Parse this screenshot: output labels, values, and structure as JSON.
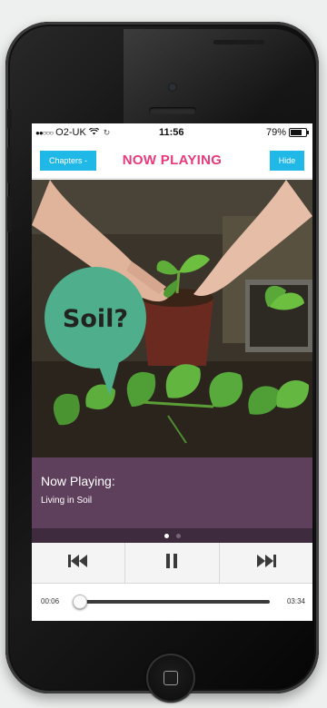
{
  "status_bar": {
    "carrier": "O2-UK",
    "time": "11:56",
    "battery": "79%"
  },
  "header": {
    "chapters_label": "Chapters -",
    "title": "NOW PLAYING",
    "hide_label": "Hide"
  },
  "artwork": {
    "bubble_text": "Soil?"
  },
  "now_playing": {
    "label": "Now Playing:",
    "track": "Living in Soil"
  },
  "pager": {
    "pages": 2,
    "active_page": 1
  },
  "controls": {
    "previous_icon": "skip-previous-icon",
    "pause_icon": "pause-icon",
    "next_icon": "skip-next-icon"
  },
  "progress": {
    "elapsed": "00:06",
    "total": "03:34",
    "fraction": 0.03
  },
  "colors": {
    "accent_blue": "#20b8e6",
    "title_pink": "#e8397a",
    "panel_purple": "#5e3f5c",
    "speech_bubble_green": "#4fae8c"
  }
}
